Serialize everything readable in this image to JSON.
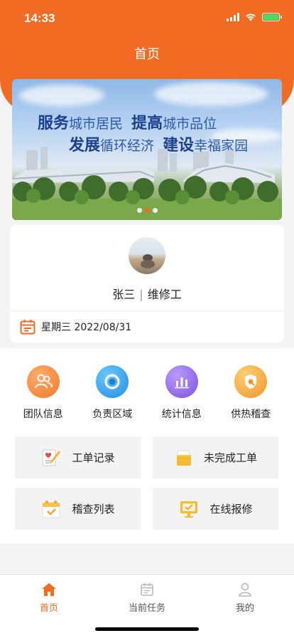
{
  "status_bar": {
    "time": "14:33"
  },
  "header": {
    "title": "首页"
  },
  "banner": {
    "line1_bold1": "服务",
    "line1_text1": "城市居民",
    "line1_bold2": "提高",
    "line1_text2": "城市品位",
    "line2_bold1": "发展",
    "line2_text1": "循环经济",
    "line2_bold2": "建设",
    "line2_text2": "幸福家园",
    "slide_count": 3,
    "active_slide": 2
  },
  "profile": {
    "name": "张三",
    "separator": "|",
    "role": "维修工",
    "date_text": "星期三 2022/08/31"
  },
  "quick_actions": [
    {
      "label": "团队信息",
      "icon": "team-icon",
      "color": "#f5853d"
    },
    {
      "label": "负责区域",
      "icon": "region-icon",
      "color": "#2fa3ea"
    },
    {
      "label": "统计信息",
      "icon": "chart-icon",
      "color": "#9069e6"
    },
    {
      "label": "供热稽查",
      "icon": "shield-icon",
      "color": "#f5a33a"
    }
  ],
  "tiles": [
    {
      "label": "工单记录",
      "icon": "work-order-icon"
    },
    {
      "label": "未完成工单",
      "icon": "folder-icon"
    },
    {
      "label": "稽查列表",
      "icon": "calendar-check-icon"
    },
    {
      "label": "在线报修",
      "icon": "monitor-icon"
    }
  ],
  "tabbar": [
    {
      "label": "首页",
      "icon": "home-icon",
      "active": true
    },
    {
      "label": "当前任务",
      "icon": "task-icon",
      "active": false
    },
    {
      "label": "我的",
      "icon": "user-icon",
      "active": false
    }
  ],
  "colors": {
    "brand": "#f26b22",
    "tab_inactive": "#b8b8b8"
  }
}
